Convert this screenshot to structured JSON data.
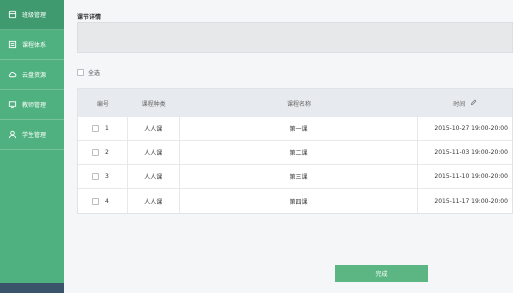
{
  "sidebar": {
    "items": [
      {
        "label": "班级管理",
        "icon": "home-icon",
        "active": true
      },
      {
        "label": "课程体系",
        "icon": "book-icon",
        "active": false
      },
      {
        "label": "云盘资源",
        "icon": "cloud-icon",
        "active": false
      },
      {
        "label": "教师管理",
        "icon": "monitor-icon",
        "active": false
      },
      {
        "label": "学生管理",
        "icon": "user-icon",
        "active": false
      }
    ],
    "accent_color": "#4fb17f",
    "active_color": "#3f9b6f"
  },
  "main": {
    "section_title": "课节详情",
    "select_all_label": "全选",
    "table": {
      "headers": [
        "编号",
        "课程种类",
        "课程名称",
        "时间"
      ],
      "rows": [
        {
          "number": "1",
          "type": "人人课",
          "name": "第一课",
          "time": "2015-10-27 19:00-20:00"
        },
        {
          "number": "2",
          "type": "人人课",
          "name": "第二课",
          "time": "2015-11-03 19:00-20:00"
        },
        {
          "number": "3",
          "type": "人人课",
          "name": "第三课",
          "time": "2015-11-10 19:00-20:00"
        },
        {
          "number": "4",
          "type": "人人课",
          "name": "第四课",
          "time": "2015-11-17 19:00-20:00"
        }
      ]
    },
    "finish_button_label": "完成"
  }
}
